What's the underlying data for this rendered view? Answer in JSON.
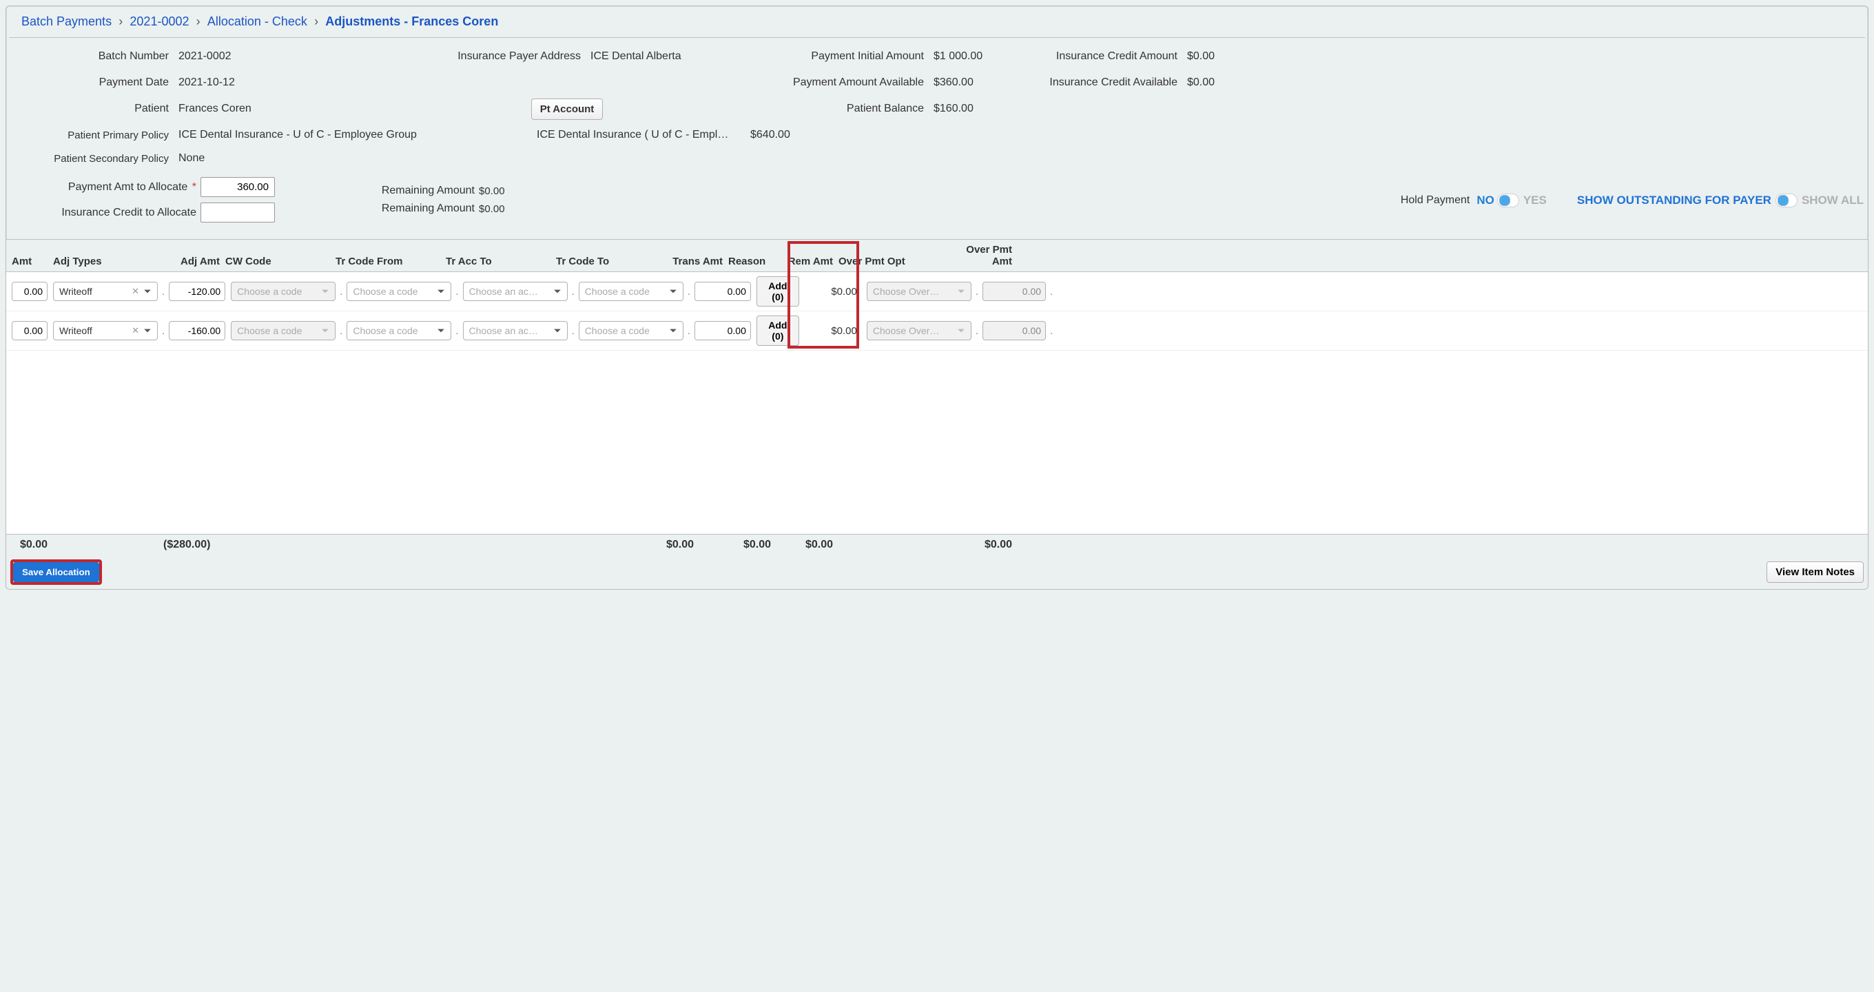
{
  "breadcrumb": {
    "items": [
      "Batch Payments",
      "2021-0002",
      "Allocation - Check"
    ],
    "current": "Adjustments - Frances Coren"
  },
  "summary": {
    "batch_number_lbl": "Batch Number",
    "batch_number": "2021-0002",
    "payment_date_lbl": "Payment Date",
    "payment_date": "2021-10-12",
    "patient_lbl": "Patient",
    "patient": "Frances Coren",
    "payer_addr_lbl": "Insurance Payer Address",
    "payer_addr": "ICE Dental Alberta",
    "pt_account_btn": "Pt Account",
    "init_amount_lbl": "Payment Initial Amount",
    "init_amount": "$1 000.00",
    "avail_lbl": "Payment Amount Available",
    "avail": "$360.00",
    "pbal_lbl": "Patient Balance",
    "pbal": "$160.00",
    "credit_amt_lbl": "Insurance Credit Amount",
    "credit_amt": "$0.00",
    "credit_avail_lbl": "Insurance Credit Available",
    "credit_avail": "$0.00",
    "primary_lbl": "Patient Primary Policy",
    "primary": "ICE Dental Insurance - U of C - Employee Group",
    "secondary_lbl": "Patient Secondary Policy",
    "secondary": "None",
    "ice_line_lbl": "ICE Dental Insurance ( U of C - Empl…",
    "ice_line_val": "$640.00"
  },
  "alloc": {
    "pay_amt_lbl": "Payment Amt to Allocate",
    "pay_amt_val": "360.00",
    "credit_lbl": "Insurance Credit to Allocate",
    "credit_val": "",
    "remain1_lbl": "Remaining Amount",
    "remain1_val": "$0.00",
    "remain2_lbl": "Remaining Amount",
    "remain2_val": "$0.00",
    "hold_lbl": "Hold Payment",
    "hold_no": "NO",
    "hold_yes": "YES",
    "show_payer": "SHOW OUTSTANDING FOR PAYER",
    "show_all": "SHOW ALL"
  },
  "grid": {
    "headers": {
      "amt": "Amt",
      "adjtypes": "Adj Types",
      "adjamt": "Adj Amt",
      "cw": "CW Code",
      "trfrom": "Tr Code From",
      "tracc": "Tr Acc To",
      "trto": "Tr Code To",
      "transamt": "Trans Amt",
      "reason": "Reason",
      "remamt": "Rem Amt",
      "overopt": "Over Pmt Opt",
      "overamt": "Over Pmt Amt"
    },
    "placeholders": {
      "cw": "Choose a code",
      "trfrom": "Choose a code",
      "tracc": "Choose an ac…",
      "trto": "Choose a code",
      "overopt": "Choose Over…"
    },
    "rows": [
      {
        "amt": "0.00",
        "adjtype": "Writeoff",
        "adjamt": "-120.00",
        "transamt": "0.00",
        "reason": "Add (0)",
        "remamt": "$0.00",
        "overamt": "0.00"
      },
      {
        "amt": "0.00",
        "adjtype": "Writeoff",
        "adjamt": "-160.00",
        "transamt": "0.00",
        "reason": "Add (0)",
        "remamt": "$0.00",
        "overamt": "0.00"
      }
    ]
  },
  "totals": {
    "amt": "$0.00",
    "adjamt": "($280.00)",
    "transamt": "$0.00",
    "reason": "$0.00",
    "remamt": "$0.00",
    "overamt": "$0.00"
  },
  "footer": {
    "save": "Save Allocation",
    "notes": "View Item Notes"
  }
}
